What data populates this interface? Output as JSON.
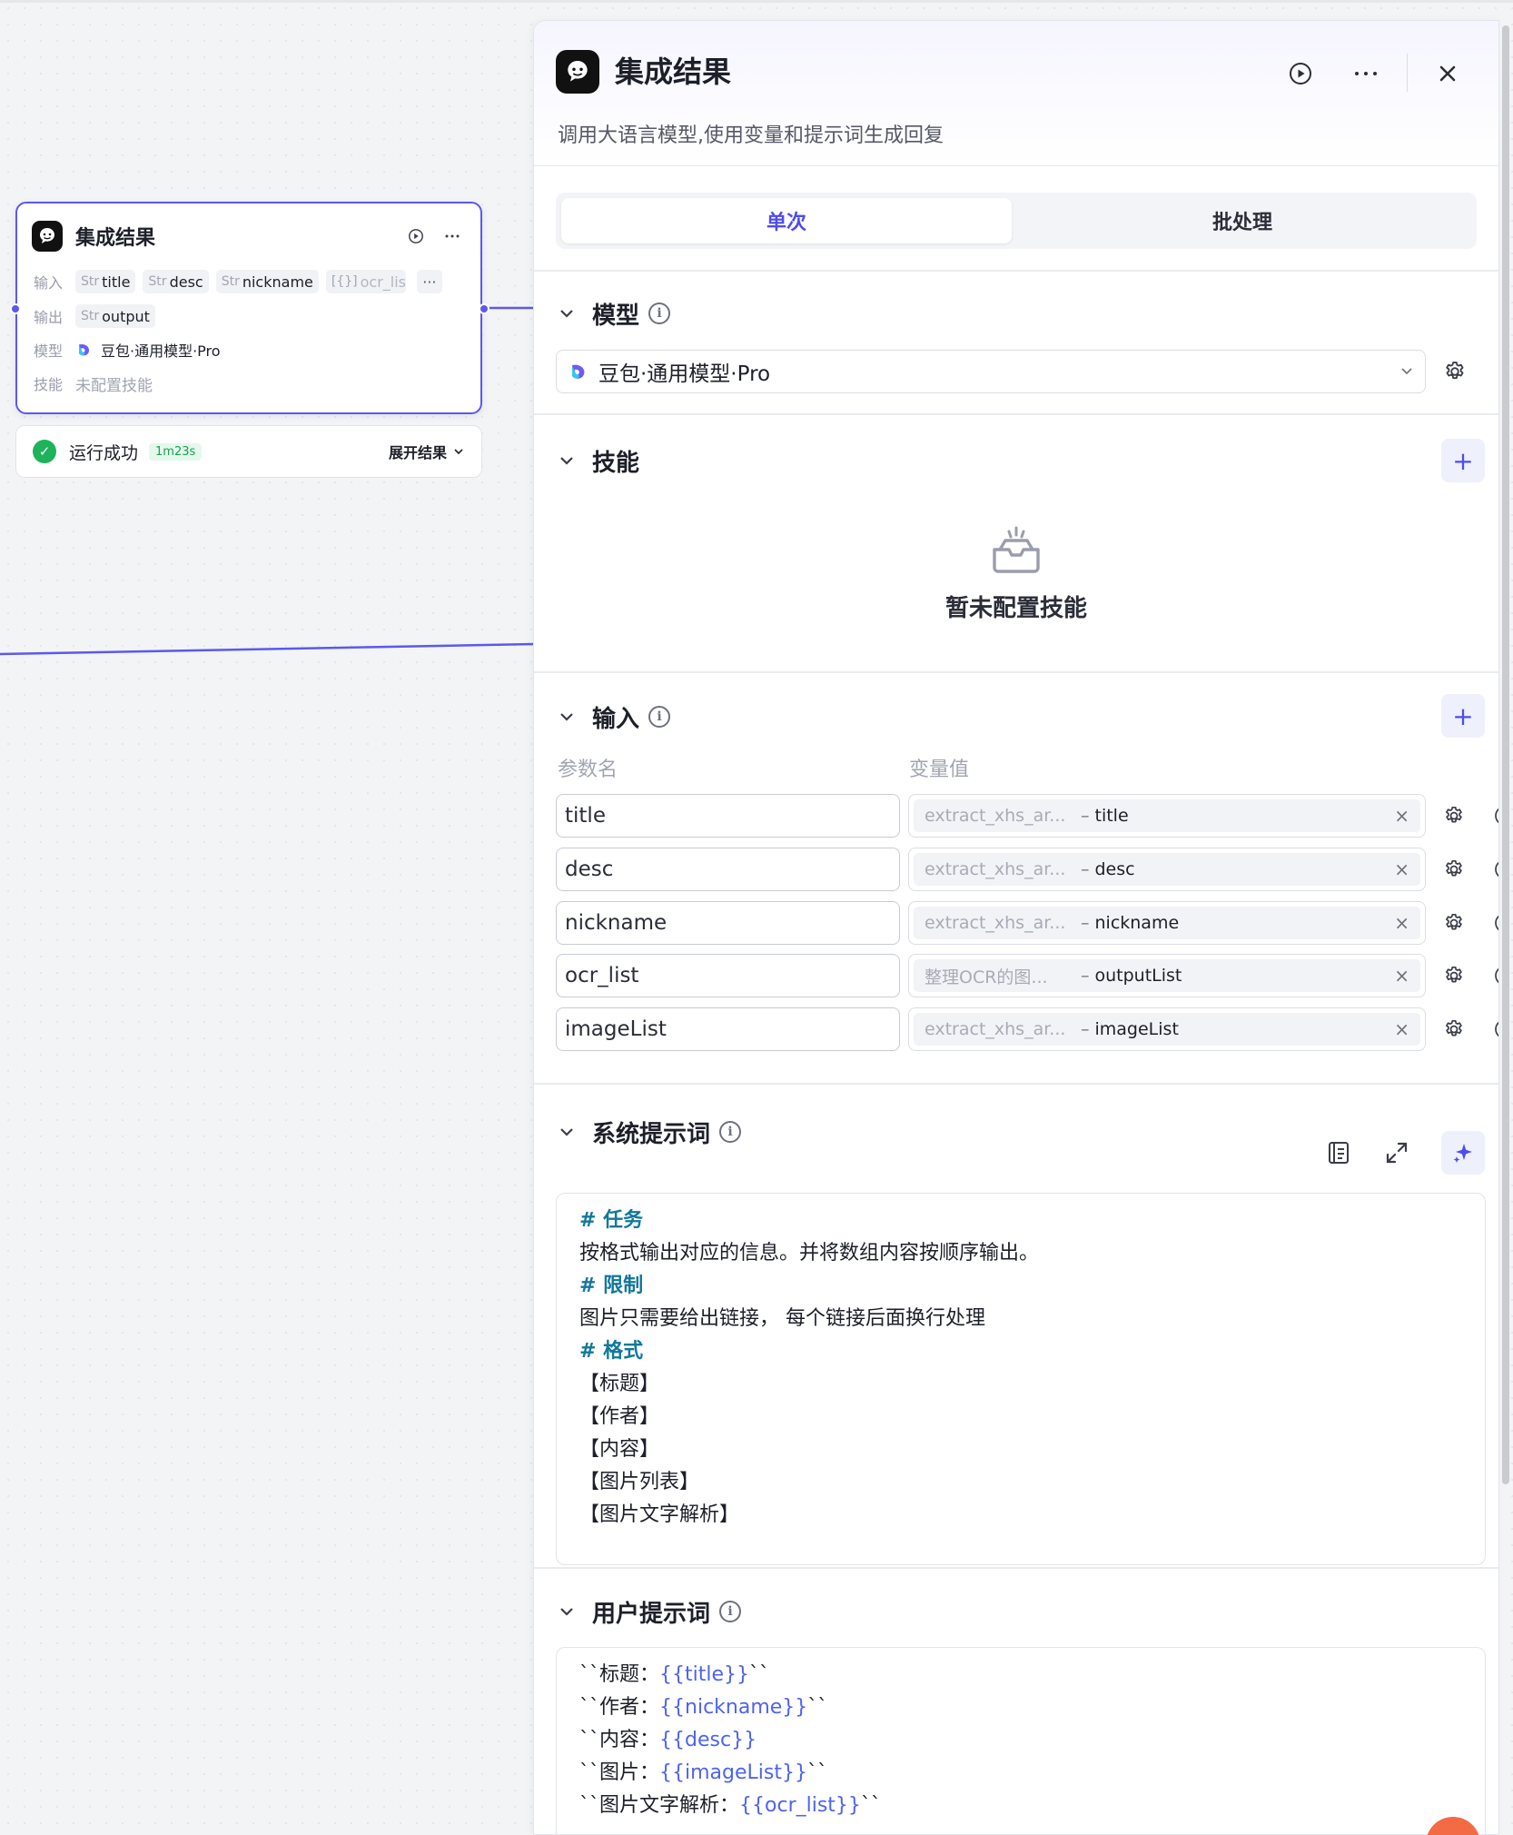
{
  "node": {
    "title": "集成结果",
    "input_label": "输入",
    "inputs": [
      {
        "type": "Str",
        "name": "title"
      },
      {
        "type": "Str",
        "name": "desc"
      },
      {
        "type": "Str",
        "name": "nickname"
      },
      {
        "type": "[{}]",
        "name": "ocr_list"
      }
    ],
    "more_tag": "···",
    "output_label": "输出",
    "output": {
      "type": "Str",
      "name": "output"
    },
    "model_label": "模型",
    "model": "豆包·通用模型·Pro",
    "skill_label": "技能",
    "skill_value": "未配置技能"
  },
  "status": {
    "text": "运行成功",
    "duration": "1m23s",
    "expand_label": "展开结果"
  },
  "panel": {
    "title": "集成结果",
    "description": "调用大语言模型,使用变量和提示词生成回复",
    "tabs": {
      "single": "单次",
      "batch": "批处理"
    },
    "model_section": {
      "title": "模型",
      "selected": "豆包·通用模型·Pro"
    },
    "skill_section": {
      "title": "技能",
      "empty_text": "暂未配置技能"
    },
    "input_section": {
      "title": "输入",
      "col_name": "参数名",
      "col_value": "变量值",
      "rows": [
        {
          "name": "title",
          "source": "extract_xhs_ar...",
          "variable": "title"
        },
        {
          "name": "desc",
          "source": "extract_xhs_ar...",
          "variable": "desc"
        },
        {
          "name": "nickname",
          "source": "extract_xhs_ar...",
          "variable": "nickname"
        },
        {
          "name": "ocr_list",
          "source": "整理OCR的图...",
          "variable": "outputList"
        },
        {
          "name": "imageList",
          "source": "extract_xhs_ar...",
          "variable": "imageList"
        }
      ]
    },
    "system_prompt": {
      "title": "系统提示词",
      "lines": [
        {
          "text": "# 任务",
          "kind": "heading"
        },
        {
          "text": "按格式输出对应的信息。并将数组内容按顺序输出。",
          "kind": "plain"
        },
        {
          "text": "# 限制",
          "kind": "heading"
        },
        {
          "text": "图片只需要给出链接， 每个链接后面换行处理",
          "kind": "plain"
        },
        {
          "text": "# 格式",
          "kind": "heading"
        },
        {
          "text": "【标题】",
          "kind": "plain"
        },
        {
          "text": "【作者】",
          "kind": "plain"
        },
        {
          "text": "【内容】",
          "kind": "plain"
        },
        {
          "text": "【图片列表】",
          "kind": "plain"
        },
        {
          "text": "【图片文字解析】",
          "kind": "plain"
        }
      ]
    },
    "user_prompt": {
      "title": "用户提示词",
      "lines": [
        {
          "prefix": "``标题：",
          "var": "{{title}}",
          "suffix": "``"
        },
        {
          "prefix": "``作者：",
          "var": "{{nickname}}",
          "suffix": "``"
        },
        {
          "prefix": "``内容：",
          "var": "{{desc}}",
          "suffix": ""
        },
        {
          "prefix": "``图片：",
          "var": "{{imageList}}",
          "suffix": "``"
        },
        {
          "prefix": "``图片文字解析：",
          "var": "{{ocr_list}}",
          "suffix": "``"
        }
      ]
    }
  },
  "colors": {
    "accent": "#4e4cf0",
    "success": "#1db35a",
    "heading": "#11789a",
    "variable": "#4e63f0"
  }
}
